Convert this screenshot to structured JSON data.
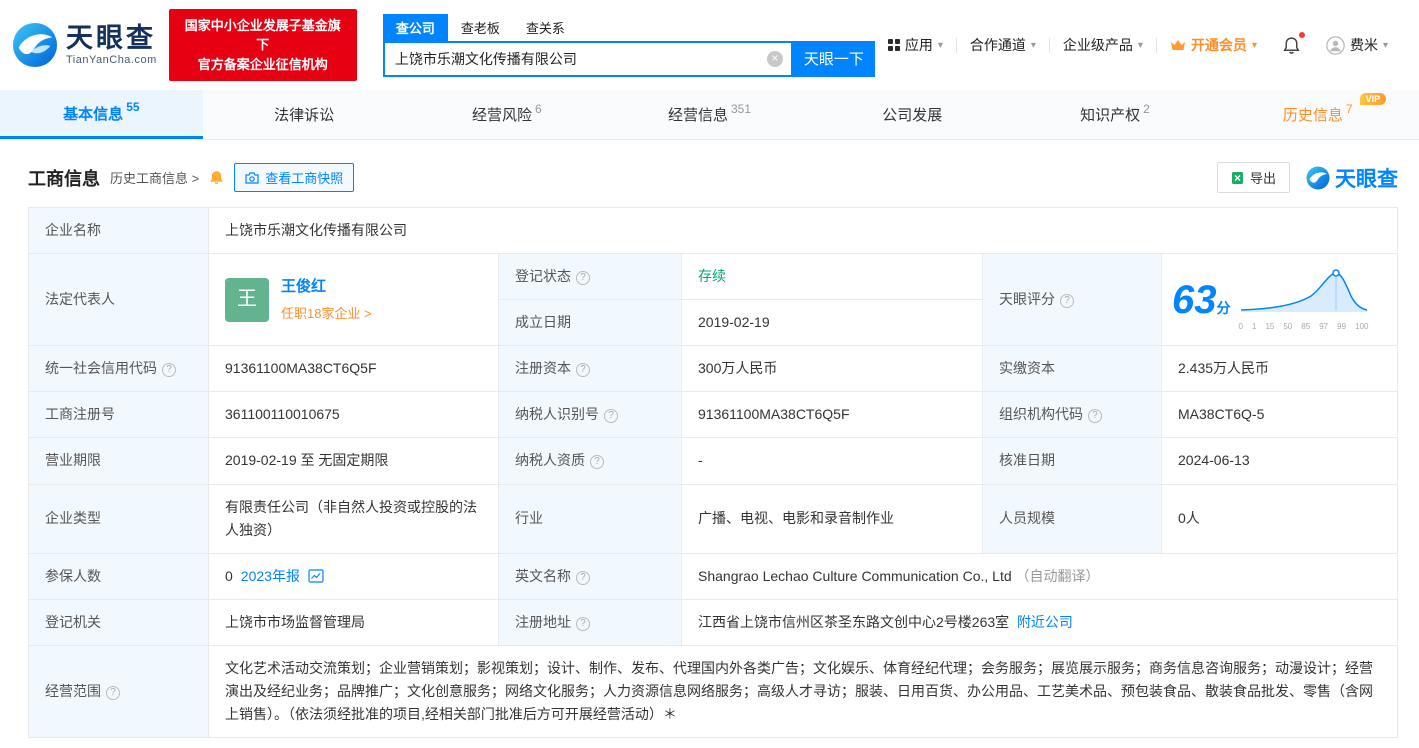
{
  "colors": {
    "primary": "#0084ff",
    "orange": "#ff8e2a",
    "status_green": "#00a971",
    "badge_red": "#e60012",
    "avatar_green": "#62b38e"
  },
  "header": {
    "logo_brand": "天眼查",
    "logo_domain": "TianYanCha.com",
    "badge_line1": "国家中小企业发展子基金旗下",
    "badge_line2": "官方备案企业征信机构",
    "search_tabs": [
      {
        "label": "查公司"
      },
      {
        "label": "查老板"
      },
      {
        "label": "查关系"
      }
    ],
    "search_value": "上饶市乐潮文化传播有限公司",
    "search_button": "天眼一下",
    "nav": [
      {
        "label": "应用"
      },
      {
        "label": "合作通道"
      },
      {
        "label": "企业级产品"
      },
      {
        "label": "开通会员"
      },
      {
        "label": "费米"
      }
    ]
  },
  "tabs": [
    {
      "label": "基本信息",
      "count": "55"
    },
    {
      "label": "法律诉讼",
      "count": ""
    },
    {
      "label": "经营风险",
      "count": "6"
    },
    {
      "label": "经营信息",
      "count": "351"
    },
    {
      "label": "公司发展",
      "count": ""
    },
    {
      "label": "知识产权",
      "count": "2"
    },
    {
      "label": "历史信息",
      "count": "7",
      "vip": "VIP"
    }
  ],
  "section": {
    "title": "工商信息",
    "history_link": "历史工商信息 >",
    "snapshot_button": "查看工商快照",
    "export_button": "导出",
    "watermark": "天眼查"
  },
  "biz": {
    "company_name_label": "企业名称",
    "company_name_value": "上饶市乐潮文化传播有限公司",
    "legal_rep_label": "法定代表人",
    "legal_rep_avatar": "王",
    "legal_rep_name": "王俊红",
    "legal_rep_positions": "任职18家企业 >",
    "reg_status_label": "登记状态",
    "reg_status_value": "存续",
    "establish_label": "成立日期",
    "establish_value": "2019-02-19",
    "score_label": "天眼评分",
    "score_value": "63",
    "score_unit": "分",
    "score_axis": [
      "0",
      "1",
      "15",
      "50",
      "85",
      "97",
      "99",
      "100"
    ],
    "credit_code_label": "统一社会信用代码",
    "credit_code_value": "91361100MA38CT6Q5F",
    "reg_capital_label": "注册资本",
    "reg_capital_value": "300万人民币",
    "paid_capital_label": "实缴资本",
    "paid_capital_value": "2.435万人民币",
    "reg_number_label": "工商注册号",
    "reg_number_value": "361100110010675",
    "taxpayer_id_label": "纳税人识别号",
    "taxpayer_id_value": "91361100MA38CT6Q5F",
    "org_code_label": "组织机构代码",
    "org_code_value": "MA38CT6Q-5",
    "business_term_label": "营业期限",
    "business_term_value": "2019-02-19 至 无固定期限",
    "taxpayer_quality_label": "纳税人资质",
    "taxpayer_quality_value": "-",
    "approval_date_label": "核准日期",
    "approval_date_value": "2024-06-13",
    "company_type_label": "企业类型",
    "company_type_value": "有限责任公司（非自然人投资或控股的法人独资）",
    "industry_label": "行业",
    "industry_value": "广播、电视、电影和录音制作业",
    "staff_size_label": "人员规模",
    "staff_size_value": "0人",
    "insured_label": "参保人数",
    "insured_value": "0",
    "insured_report_link": "2023年报",
    "english_name_label": "英文名称",
    "english_name_value": "Shangrao Lechao Culture Communication Co., Ltd",
    "english_name_note": "（自动翻译）",
    "reg_authority_label": "登记机关",
    "reg_authority_value": "上饶市市场监督管理局",
    "reg_address_label": "注册地址",
    "reg_address_value": "江西省上饶市信州区茶圣东路文创中心2号楼263室",
    "nearby_link": "附近公司",
    "business_scope_label": "经营范围",
    "business_scope_value": "文化艺术活动交流策划；企业营销策划；影视策划；设计、制作、发布、代理国内外各类广告；文化娱乐、体育经纪代理；会务服务；展览展示服务；商务信息咨询服务；动漫设计；经营演出及经纪业务；品牌推广；文化创意服务；网络文化服务；人力资源信息网络服务；高级人才寻访；服装、日用百货、办公用品、工艺美术品、预包装食品、散装食品批发、零售（含网上销售）。（依法须经批准的项目,经相关部门批准后方可开展经营活动）＊"
  }
}
